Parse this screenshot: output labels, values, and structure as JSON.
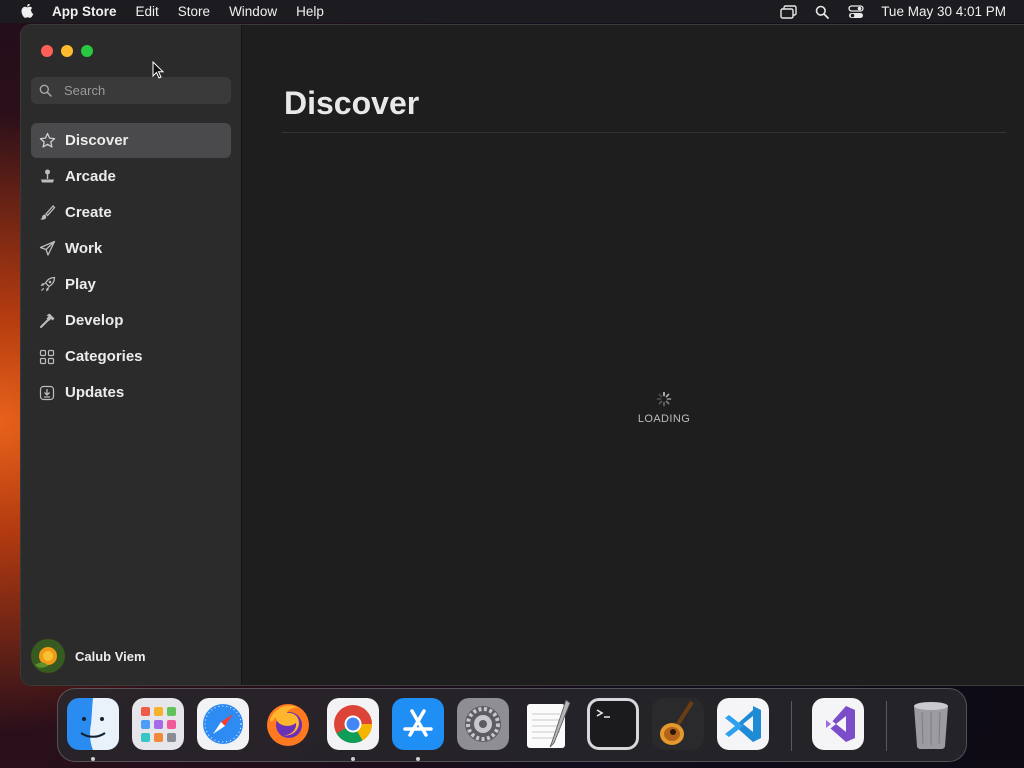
{
  "menubar": {
    "app_name": "App Store",
    "items": [
      "Edit",
      "Store",
      "Window",
      "Help"
    ],
    "clock": "Tue May 30  4:01 PM",
    "status_icons": [
      "screen-mirroring-icon",
      "spotlight-search-icon",
      "control-center-icon"
    ]
  },
  "window": {
    "search": {
      "placeholder": "Search",
      "value": ""
    },
    "nav": [
      {
        "label": "Discover",
        "icon": "star-icon",
        "active": true
      },
      {
        "label": "Arcade",
        "icon": "joystick-icon",
        "active": false
      },
      {
        "label": "Create",
        "icon": "brush-icon",
        "active": false
      },
      {
        "label": "Work",
        "icon": "paper-plane-icon",
        "active": false
      },
      {
        "label": "Play",
        "icon": "rocket-icon",
        "active": false
      },
      {
        "label": "Develop",
        "icon": "hammer-icon",
        "active": false
      },
      {
        "label": "Categories",
        "icon": "grid-icon",
        "active": false
      },
      {
        "label": "Updates",
        "icon": "download-icon",
        "active": false
      }
    ],
    "profile": {
      "name": "Calub Viem"
    },
    "main": {
      "title": "Discover",
      "loading_text": "LOADING"
    }
  },
  "dock": {
    "apps": [
      {
        "name": "finder",
        "running": true
      },
      {
        "name": "launchpad",
        "running": false
      },
      {
        "name": "safari",
        "running": false
      },
      {
        "name": "firefox",
        "running": false
      },
      {
        "name": "chrome",
        "running": true
      },
      {
        "name": "app-store",
        "running": true
      },
      {
        "name": "system-settings",
        "running": false
      },
      {
        "name": "textedit",
        "running": false
      },
      {
        "name": "terminal",
        "running": false
      },
      {
        "name": "garageband",
        "running": false
      },
      {
        "name": "vscode",
        "running": false
      },
      {
        "name": "visual-studio",
        "running": false
      },
      {
        "name": "trash",
        "running": false
      }
    ]
  },
  "colors": {
    "accent_close": "#fe5f57",
    "accent_minimize": "#febc2e",
    "accent_maximize": "#28c840",
    "sidebar_bg": "#2b2b2c",
    "content_bg": "#1e1e1e"
  }
}
